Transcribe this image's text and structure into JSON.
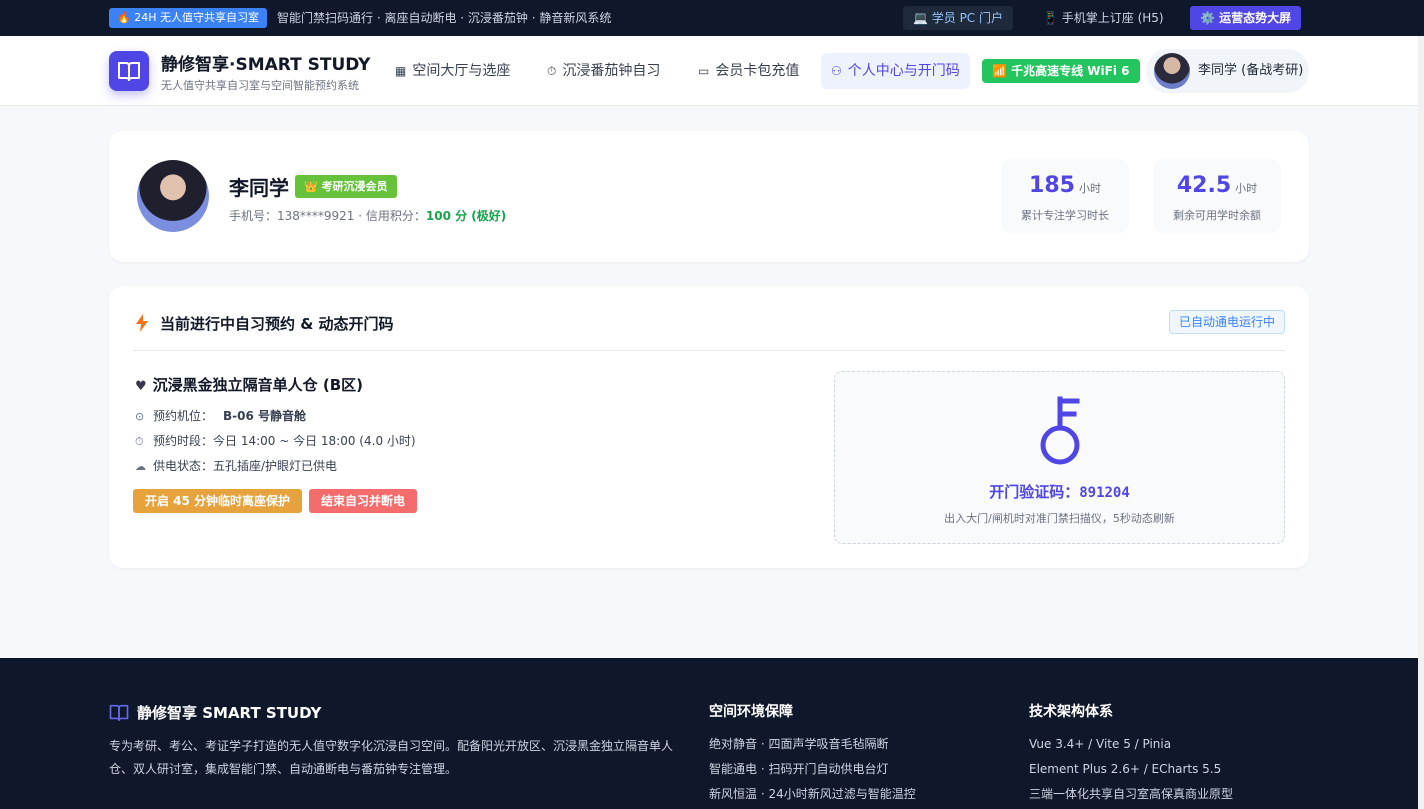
{
  "topbar": {
    "badge": "🔥 24H 无人值守共享自习室",
    "notice": "智能门禁扫码通行 · 离座自动断电 · 沉浸番茄钟 · 静音新风系统",
    "pc_portal": "💻 学员 PC 门户",
    "h5_booking": "📱 手机掌上订座 (H5)",
    "ops_screen": "⚙️ 运营态势大屏"
  },
  "header": {
    "brand_title": "静修智享·SMART STUDY",
    "brand_sub": "无人值守共享自习室与空间智能预约系统",
    "nav": [
      {
        "label": "空间大厅与选座",
        "icon": "grid-icon"
      },
      {
        "label": "沉浸番茄钟自习",
        "icon": "timer-icon"
      },
      {
        "label": "会员卡包充值",
        "icon": "card-icon"
      },
      {
        "label": "个人中心与开门码",
        "icon": "user-icon",
        "active": true
      }
    ],
    "wifi": "📶 千兆高速专线 WiFi 6",
    "user_name": "李同学 (备战考研)"
  },
  "profile": {
    "name": "李同学",
    "member_badge": "👑 考研沉浸会员",
    "meta_prefix": "手机号：138****9921 · 信用积分：",
    "credit_score": "100 分 (极好)",
    "stats": [
      {
        "value": "185",
        "unit": "小时",
        "label": "累计专注学习时长"
      },
      {
        "value": "42.5",
        "unit": "小时",
        "label": "剩余可用学时余额"
      }
    ]
  },
  "booking": {
    "title": "当前进行中自习预约 & 动态开门码",
    "status": "已自动通电运行中",
    "room_name": "沉浸黑金独立隔音单人仓 (B区)",
    "seat_label": "预约机位：",
    "seat_value": "B-06 号静音舱",
    "time_label": "预约时段：",
    "time_value": "今日 14:00 ~ 今日 18:00 (4.0 小时)",
    "power_label": "供电状态：",
    "power_value": "五孔插座/护眼灯已供电",
    "btn_protect": "开启 45 分钟临时离座保护",
    "btn_end": "结束自习并断电",
    "code_label": "开门验证码：",
    "code_value": "891204",
    "code_hint": "出入大门/闸机时对准门禁扫描仪，5秒动态刷新"
  },
  "footer": {
    "brand": "静修智享 SMART STUDY",
    "desc": "专为考研、考公、考证学子打造的无人值守数字化沉浸自习空间。配备阳光开放区、沉浸黑金独立隔音单人仓、双人研讨室，集成智能门禁、自动通断电与番茄钟专注管理。",
    "col1_title": "空间环境保障",
    "col1_items": [
      "绝对静音 · 四面声学吸音毛毡隔断",
      "智能通电 · 扫码开门自动供电台灯",
      "新风恒温 · 24小时新风过滤与智能温控"
    ],
    "col2_title": "技术架构体系",
    "col2_items": [
      "Vue 3.4+ / Vite 5 / Pinia",
      "Element Plus 2.6+ / ECharts 5.5",
      "三端一体化共享自习室高保真商业原型"
    ]
  },
  "colors": {
    "accent": "#4f46e5",
    "success": "#22c55e",
    "warning": "#e6a23c",
    "danger": "#f56c6c",
    "dark": "#0f172a"
  }
}
